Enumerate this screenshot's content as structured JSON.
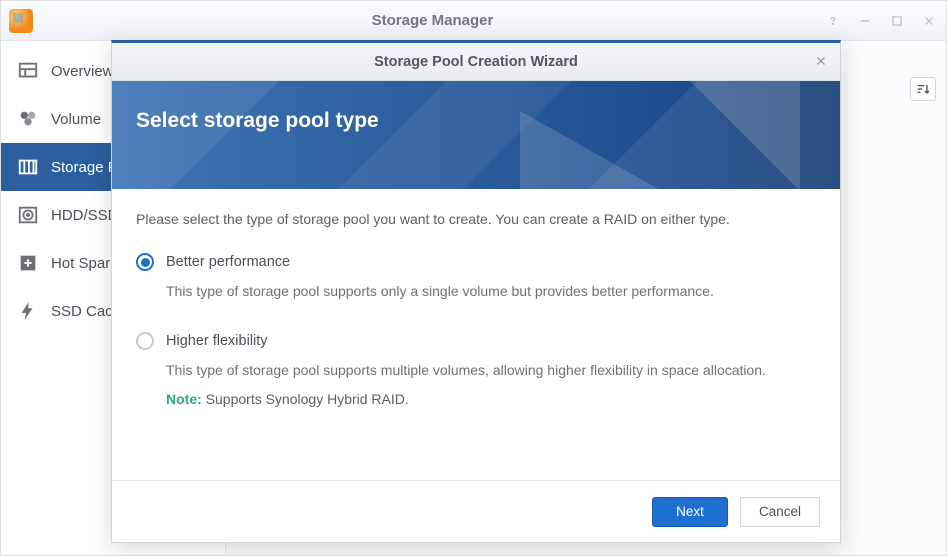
{
  "window": {
    "title": "Storage Manager"
  },
  "sidebar": {
    "items": [
      {
        "label": "Overview"
      },
      {
        "label": "Volume"
      },
      {
        "label": "Storage Pool"
      },
      {
        "label": "HDD/SSD"
      },
      {
        "label": "Hot Spare"
      },
      {
        "label": "SSD Cache"
      }
    ]
  },
  "modal": {
    "title": "Storage Pool Creation Wizard",
    "heading": "Select storage pool type",
    "intro": "Please select the type of storage pool you want to create. You can create a RAID on either type.",
    "options": [
      {
        "label": "Better performance",
        "desc": "This type of storage pool supports only a single volume but provides better performance.",
        "selected": true
      },
      {
        "label": "Higher flexibility",
        "desc": "This type of storage pool supports multiple volumes, allowing higher flexibility in space allocation.",
        "selected": false,
        "note_label": "Note:",
        "note_text": " Supports Synology Hybrid RAID."
      }
    ],
    "buttons": {
      "next": "Next",
      "cancel": "Cancel"
    }
  }
}
